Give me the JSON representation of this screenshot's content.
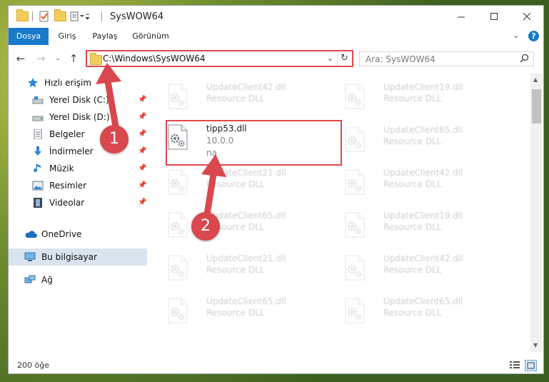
{
  "window": {
    "title": "SysWOW64"
  },
  "ribbon": {
    "tabs": [
      "Dosya",
      "Giriş",
      "Paylaş",
      "Görünüm"
    ]
  },
  "address": {
    "path": "C:\\Windows\\SysWOW64"
  },
  "search": {
    "placeholder": "Ara: SysWOW64"
  },
  "sidebar": {
    "items": [
      {
        "label": "Hızlı erişim"
      },
      {
        "label": "Yerel Disk (C:)"
      },
      {
        "label": "Yerel Disk (D:)"
      },
      {
        "label": "Belgeler"
      },
      {
        "label": "İndirmeler"
      },
      {
        "label": "Müzik"
      },
      {
        "label": "Resimler"
      },
      {
        "label": "Videolar"
      },
      {
        "label": "OneDrive"
      },
      {
        "label": "Bu bilgisayar"
      },
      {
        "label": "Ağ"
      }
    ]
  },
  "files": {
    "highlighted": {
      "name": "tipp53.dll",
      "version": "10.0.0",
      "extra": "na"
    },
    "left": [
      {
        "name": "UpdateClient42.dll",
        "type": "Resource DLL"
      },
      {
        "name": "UpdateClient21.dll",
        "type": "Resource DLL"
      },
      {
        "name": "UpdateClient65.dll",
        "type": "Resource DLL"
      },
      {
        "name": "UpdateClient21.dll",
        "type": "Resource DLL"
      },
      {
        "name": "UpdateClient65.dll",
        "type": "Resource DLL"
      }
    ],
    "right": [
      {
        "name": "UpdateClient19.dll",
        "type": "Resource DLL"
      },
      {
        "name": "UpdateClient65.dll",
        "type": "Resource DLL"
      },
      {
        "name": "UpdateClient42.dll",
        "type": "Resource DLL"
      },
      {
        "name": "UpdateClient19.dll",
        "type": "Resource DLL"
      },
      {
        "name": "UpdateClient42.dll",
        "type": "Resource DLL"
      },
      {
        "name": "UpdateClient65.dll",
        "type": "Resource DLL"
      }
    ]
  },
  "status": {
    "count": "200 öğe"
  },
  "annotations": {
    "one": "1",
    "two": "2"
  },
  "colors": {
    "accent": "#1979ca",
    "highlight": "#e0474c",
    "badge": "#d9484e"
  }
}
